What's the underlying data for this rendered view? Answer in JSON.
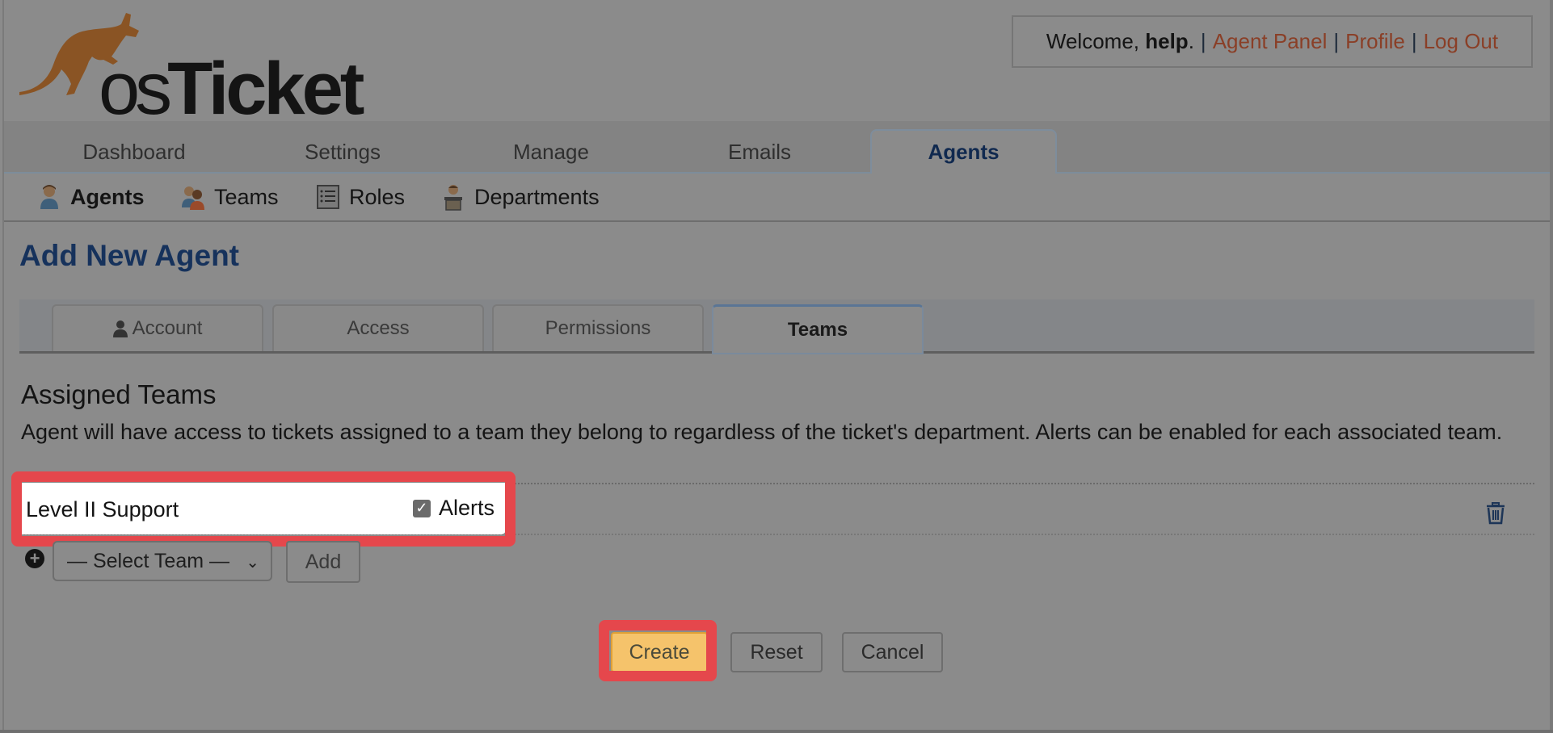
{
  "header": {
    "logo_text_os": "os",
    "logo_text_ticket": "Ticket",
    "welcome_prefix": "Welcome, ",
    "username": "help",
    "welcome_suffix": ".",
    "separator": "|",
    "links": [
      "Agent Panel",
      "Profile",
      "Log Out"
    ]
  },
  "nav": {
    "tabs": [
      {
        "label": "Dashboard",
        "active": false
      },
      {
        "label": "Settings",
        "active": false
      },
      {
        "label": "Manage",
        "active": false
      },
      {
        "label": "Emails",
        "active": false
      },
      {
        "label": "Agents",
        "active": true
      }
    ]
  },
  "subnav": {
    "items": [
      {
        "label": "Agents",
        "icon": "agent-icon",
        "active": true
      },
      {
        "label": "Teams",
        "icon": "teams-icon",
        "active": false
      },
      {
        "label": "Roles",
        "icon": "roles-list-icon",
        "active": false
      },
      {
        "label": "Departments",
        "icon": "department-icon",
        "active": false
      }
    ]
  },
  "page": {
    "title": "Add New Agent"
  },
  "form_tabs": [
    {
      "label": "Account",
      "icon": "user-icon",
      "active": false
    },
    {
      "label": "Access",
      "active": false
    },
    {
      "label": "Permissions",
      "active": false
    },
    {
      "label": "Teams",
      "active": true
    }
  ],
  "teams_section": {
    "title": "Assigned Teams",
    "description": "Agent will have access to tickets assigned to a team they belong to regardless of the ticket's department. Alerts can be enabled for each associated team.",
    "assigned": [
      {
        "name": "Level II Support",
        "alerts_label": "Alerts",
        "alerts_checked": true
      }
    ],
    "select_placeholder": "— Select Team —",
    "add_label": "Add"
  },
  "actions": {
    "create": "Create",
    "reset": "Reset",
    "cancel": "Cancel"
  },
  "colors": {
    "highlight": "#e5474c",
    "primary_button": "#f5c36b",
    "link": "#8a3f27",
    "title": "#16325c"
  }
}
